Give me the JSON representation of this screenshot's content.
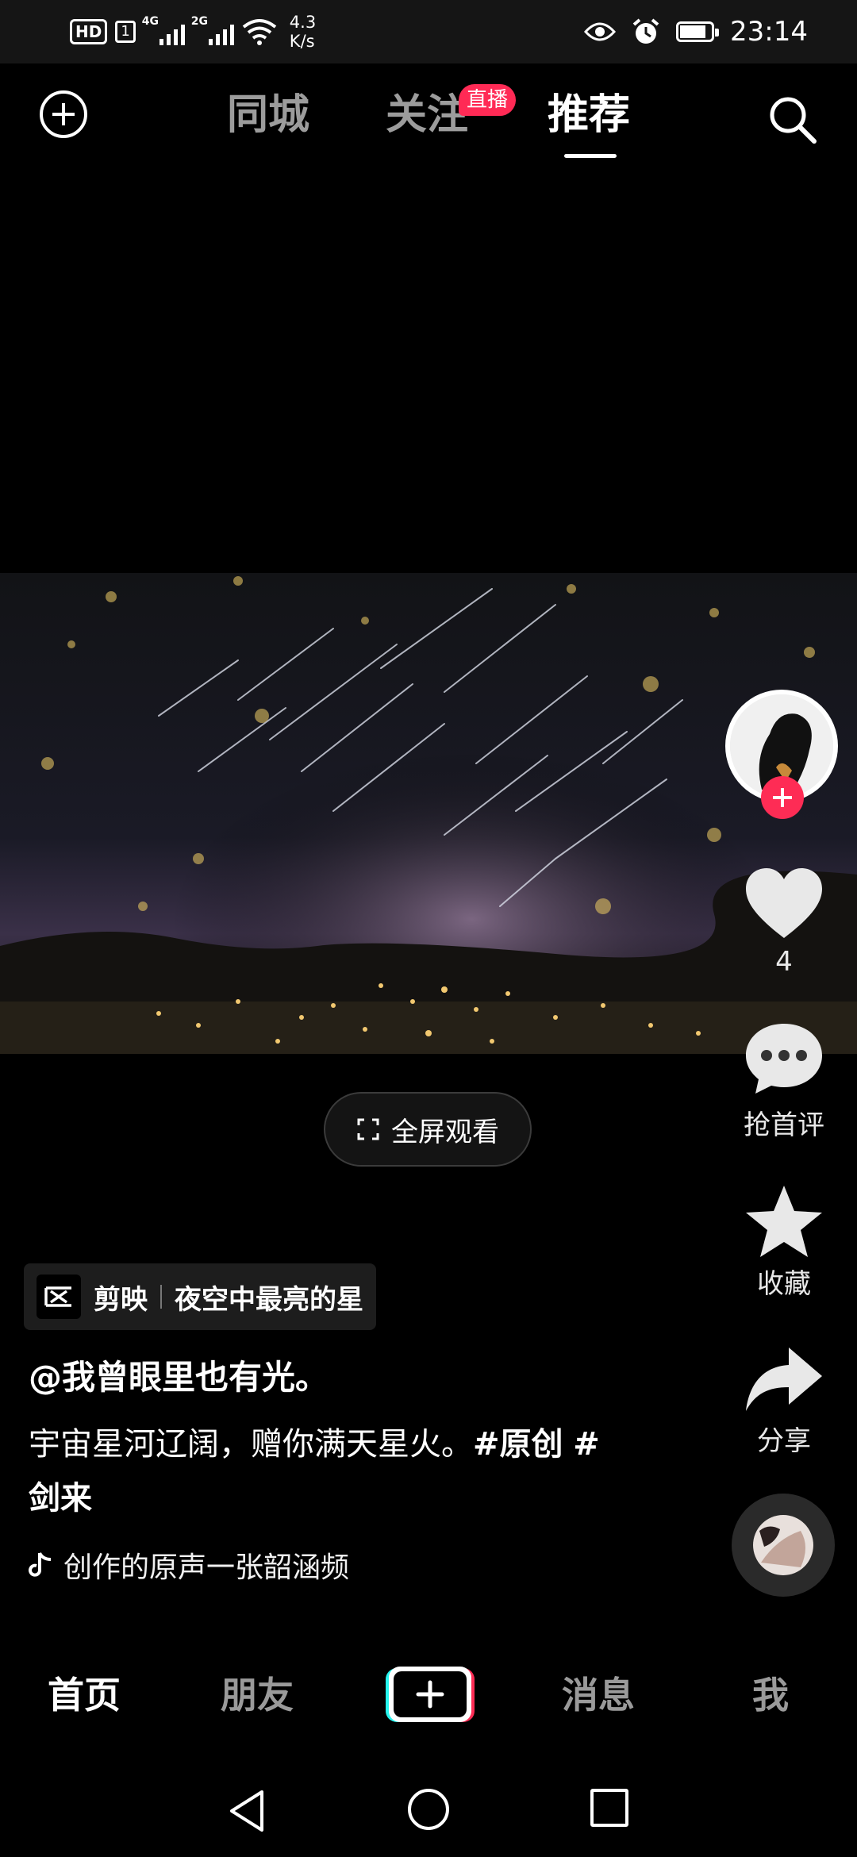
{
  "status_bar": {
    "hd": "HD",
    "sim": "1",
    "net1": "4G",
    "net2": "2G",
    "speed_value": "4.3",
    "speed_unit": "K/s",
    "time": "23:14"
  },
  "top_tabs": {
    "local": "同城",
    "following": "关注",
    "recommend": "推荐",
    "live_badge": "直播",
    "active": "推荐"
  },
  "video": {
    "fullscreen_label": "全屏观看"
  },
  "right_rail": {
    "likes": "4",
    "comment_label": "抢首评",
    "favorite_label": "收藏",
    "share_label": "分享"
  },
  "info": {
    "capcut_app": "剪映",
    "capcut_template": "夜空中最亮的星",
    "author": "@我曾眼里也有光。",
    "caption_text": "宇宙星河辽阔，赠你满天星火。",
    "hashtag1": "#原创",
    "hashtag2": "#剑来",
    "music": "创作的原声一张韶涵频"
  },
  "bottom_nav": {
    "home": "首页",
    "friends": "朋友",
    "messages": "消息",
    "me": "我",
    "active": "首页"
  },
  "colors": {
    "accent": "#fe2c55",
    "badge": "#ff2a55",
    "inactive_tab": "#9c9c9c"
  },
  "battery_charge": 0.85
}
